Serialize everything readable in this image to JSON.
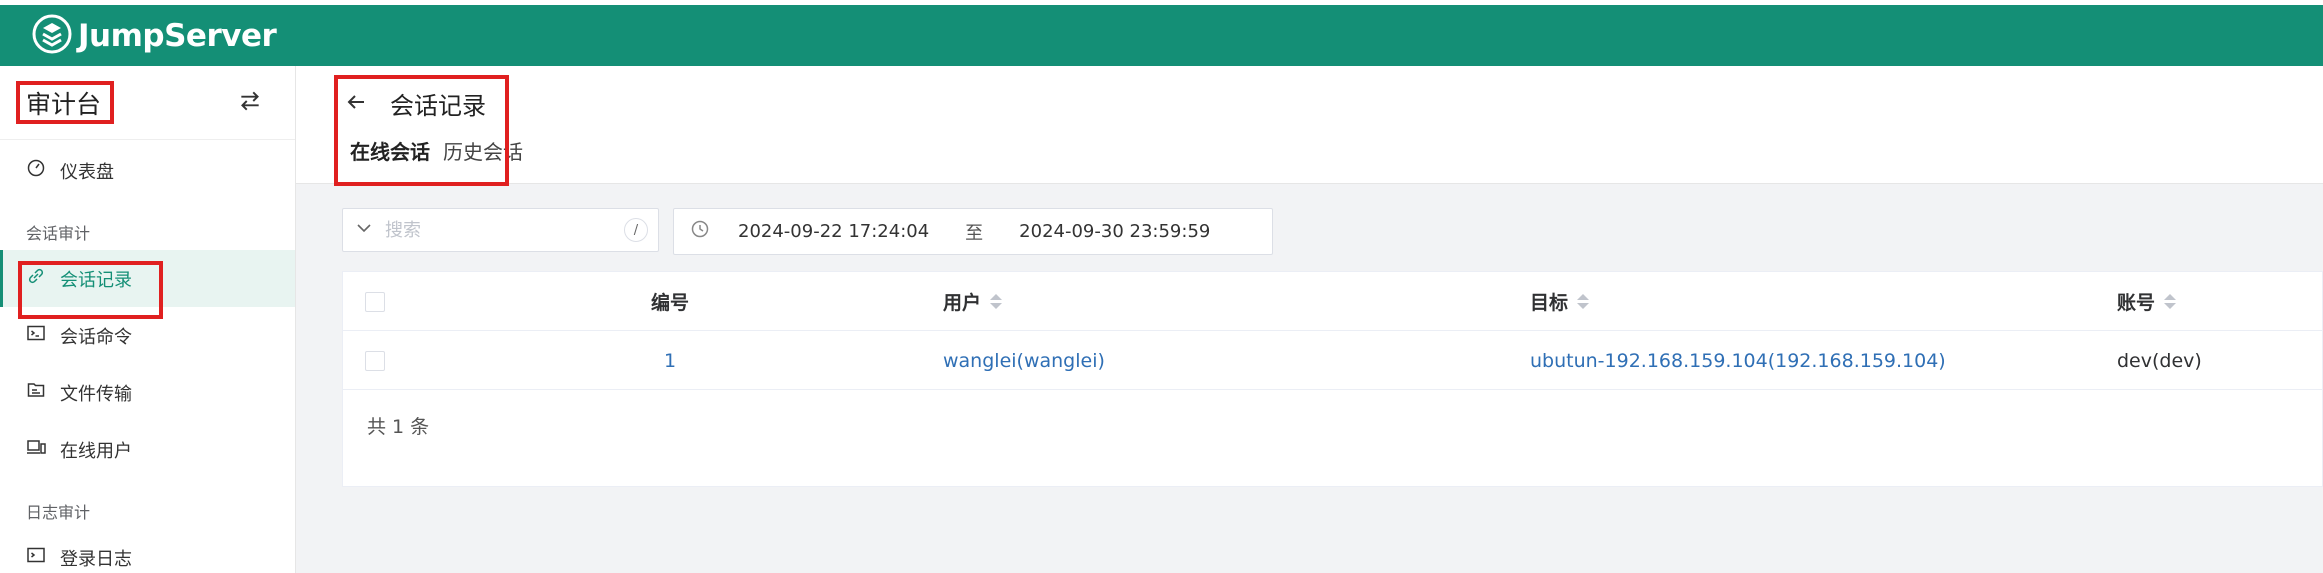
{
  "app": {
    "name": "JumpServer"
  },
  "sidebar": {
    "view_title": "审计台",
    "items": [
      {
        "label": "仪表盘",
        "icon": "dashboard-icon"
      },
      {
        "group": "会话审计"
      },
      {
        "label": "会话记录",
        "icon": "link-icon",
        "active": true
      },
      {
        "label": "会话命令",
        "icon": "terminal-icon"
      },
      {
        "label": "文件传输",
        "icon": "file-transfer-icon"
      },
      {
        "label": "在线用户",
        "icon": "devices-icon"
      },
      {
        "group": "日志审计"
      },
      {
        "label": "登录日志",
        "icon": "login-log-icon"
      }
    ]
  },
  "page": {
    "title": "会话记录",
    "tabs": [
      {
        "label": "在线会话",
        "active": true
      },
      {
        "label": "历史会话",
        "active": false
      }
    ]
  },
  "filters": {
    "search_placeholder": "搜索",
    "shortcut": "/",
    "date_from": "2024-09-22 17:24:04",
    "date_sep": "至",
    "date_to": "2024-09-30 23:59:59"
  },
  "table": {
    "headers": {
      "id": "编号",
      "user": "用户",
      "target": "目标",
      "account": "账号"
    },
    "rows": [
      {
        "id": "1",
        "user": "wanglei(wanglei)",
        "target": "ubutun-192.168.159.104(192.168.159.104)",
        "account": "dev(dev)"
      }
    ],
    "total_label": "共 1 条"
  },
  "colors": {
    "brand": "#148f76",
    "link": "#2f6fb5",
    "highlight": "#e02020"
  }
}
